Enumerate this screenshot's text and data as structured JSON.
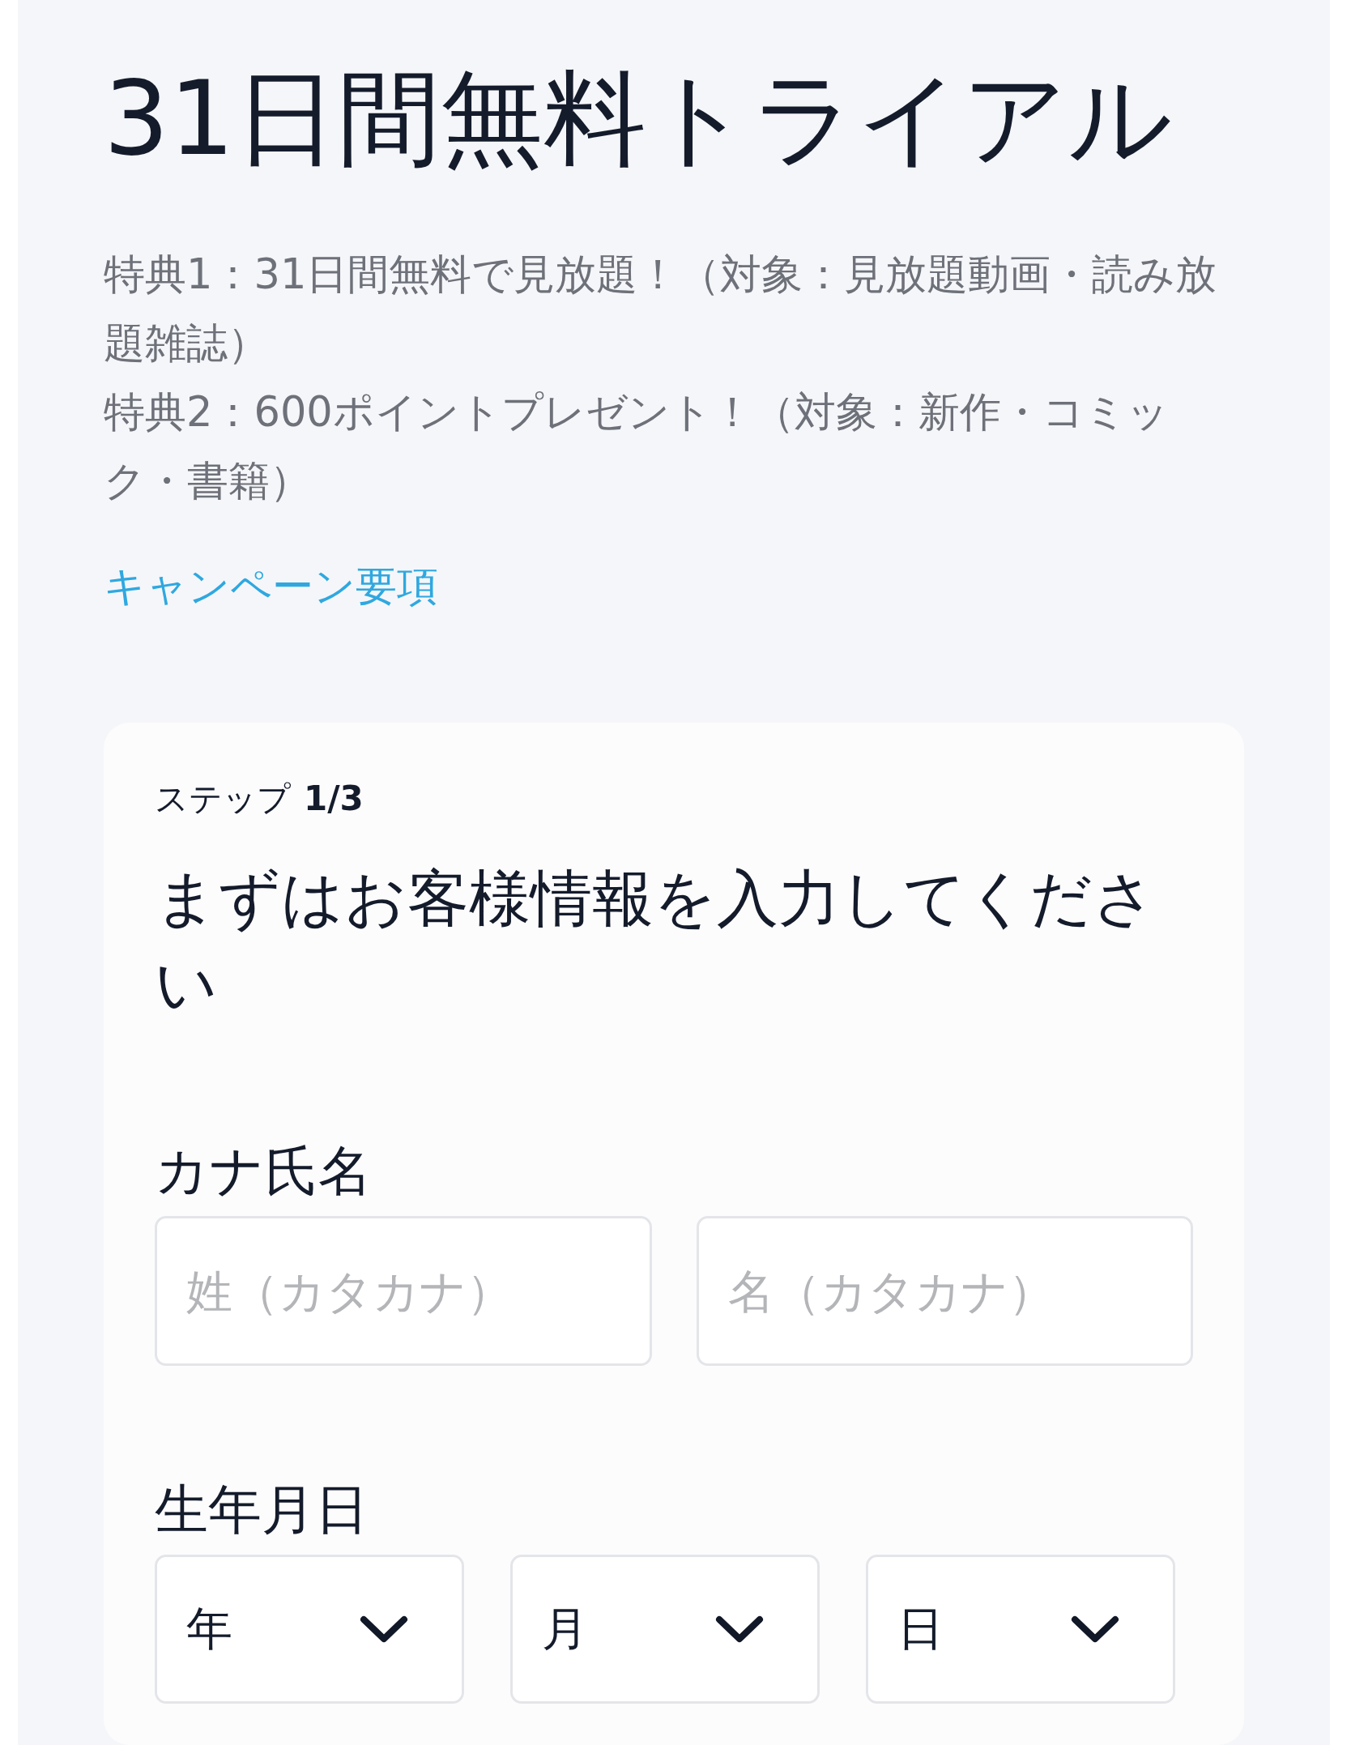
{
  "title": "31日間無料トライアル",
  "benefits": [
    "特典1：31日間無料で見放題！（対象：見放題動画・読み放題雑誌）",
    "特典2：600ポイントプレゼント！（対象：新作・コミック・書籍）"
  ],
  "campaign_link": "キャンペーン要項",
  "form": {
    "step_label": "ステップ",
    "step": "1/3",
    "heading": "まずはお客様情報を入力してください",
    "fields": [
      {
        "label": "カナ氏名",
        "kind": "text",
        "inputs": [
          {
            "placeholder": "姓（カタカナ）"
          },
          {
            "placeholder": "名（カタカナ）"
          }
        ]
      },
      {
        "label": "生年月日",
        "kind": "select",
        "inputs": [
          {
            "value": "年"
          },
          {
            "value": "月"
          },
          {
            "value": "日"
          }
        ]
      }
    ]
  }
}
